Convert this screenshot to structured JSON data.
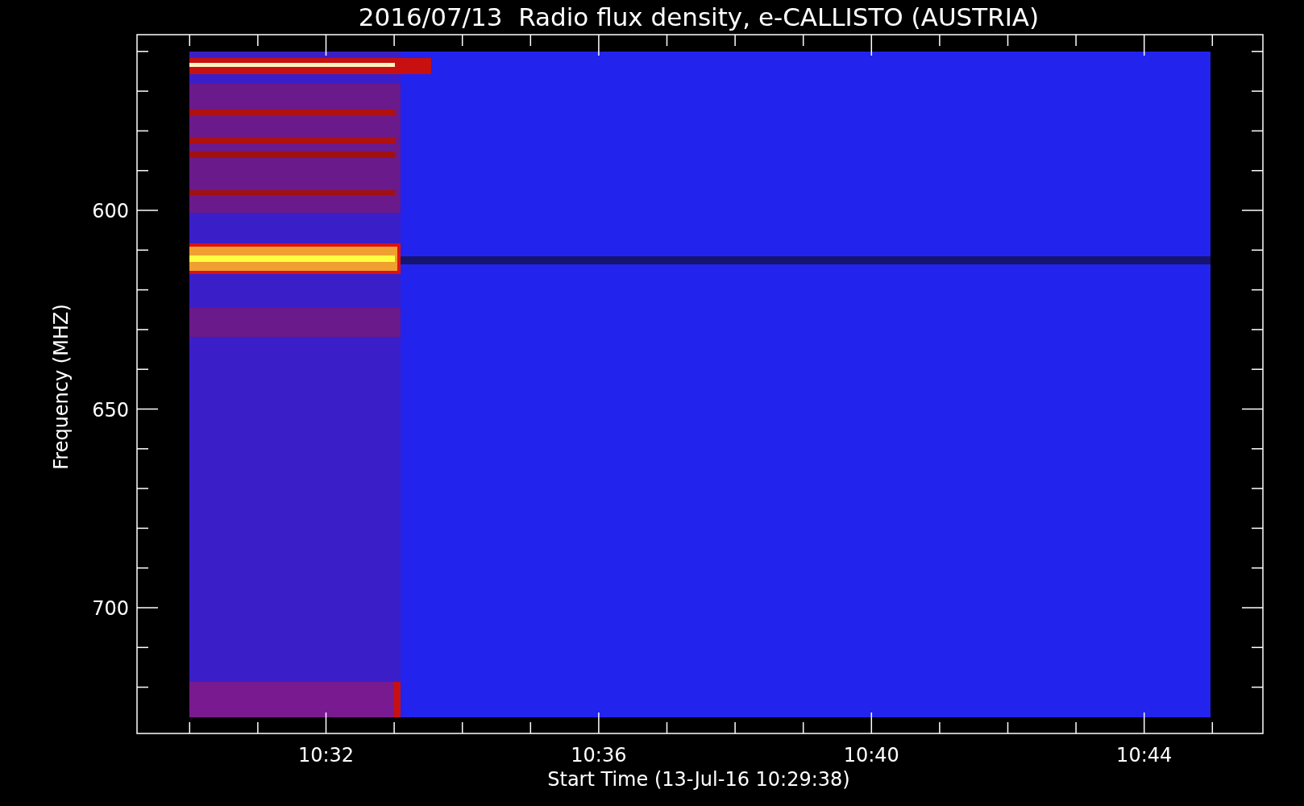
{
  "title": "2016/07/13  Radio flux density, e-CALLISTO (AUSTRIA)",
  "y_axis": {
    "label": "Frequency (MHZ)",
    "ticks": [
      "600",
      "650",
      "700"
    ]
  },
  "x_axis": {
    "label": "Start Time (13-Jul-16 10:29:38)",
    "ticks": [
      "10:32",
      "10:36",
      "10:40",
      "10:44"
    ]
  },
  "plot": {
    "kind": "spectrogram"
  }
}
